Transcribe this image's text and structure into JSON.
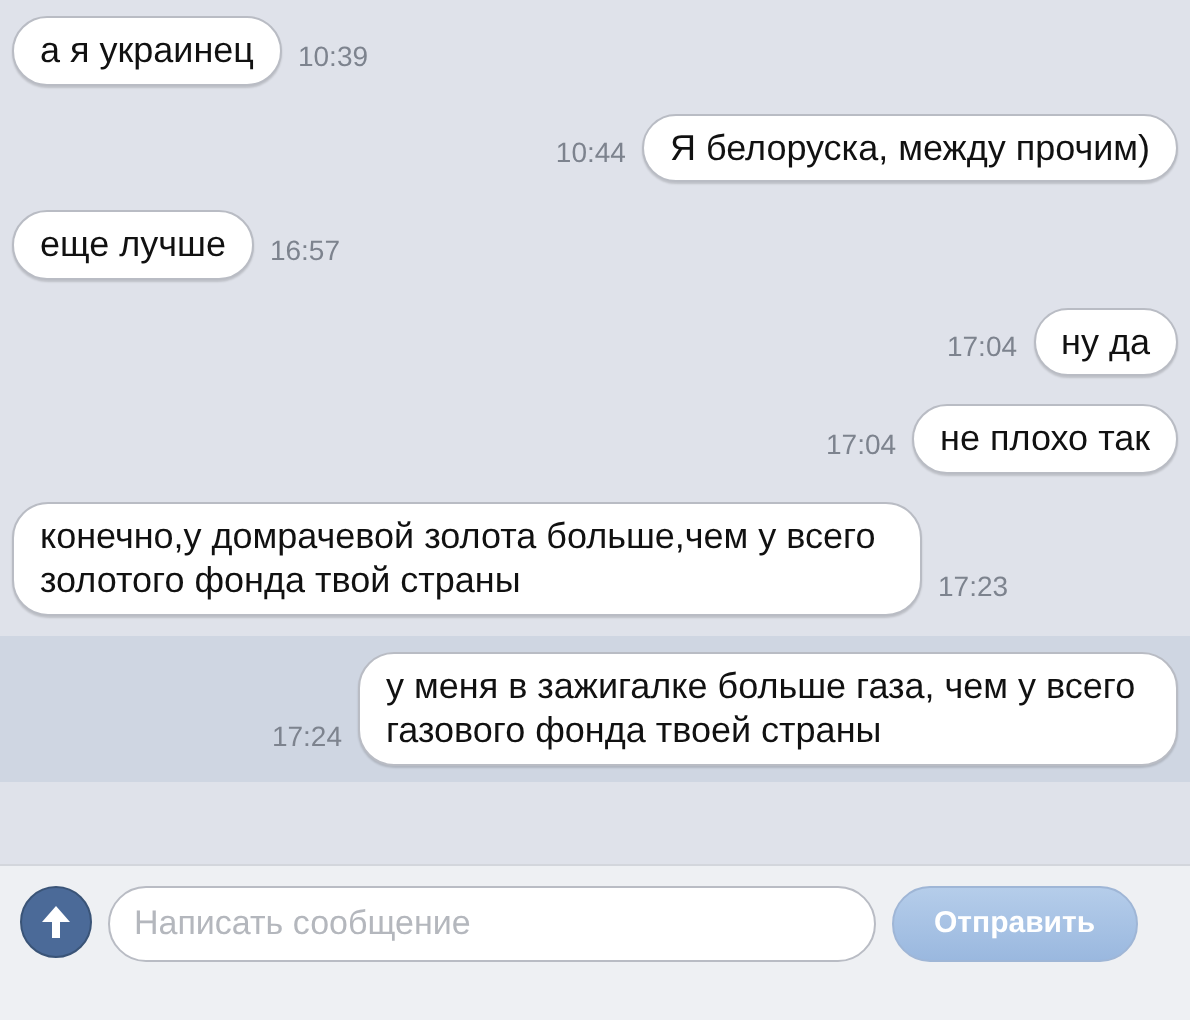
{
  "messages": [
    {
      "kind": "in",
      "text": "а я украинец",
      "time": "10:39",
      "selected": false
    },
    {
      "kind": "out",
      "text": "Я белоруска, между прочим)",
      "time": "10:44",
      "selected": false
    },
    {
      "kind": "in",
      "text": "еще лучше",
      "time": "16:57",
      "selected": false
    },
    {
      "kind": "out",
      "text": "ну да",
      "time": "17:04",
      "selected": false
    },
    {
      "kind": "out",
      "text": "не плохо так",
      "time": "17:04",
      "selected": false
    },
    {
      "kind": "in",
      "text": "конечно,у домрачевой золота больше,чем у всего золотого фонда твой страны",
      "time": "17:23",
      "selected": false
    },
    {
      "kind": "out",
      "text": "у меня в зажигалке больше газа, чем у всего газового фонда твоей страны",
      "time": "17:24",
      "selected": true
    }
  ],
  "composer": {
    "placeholder": "Написать сообщение",
    "send_button": "Отправить"
  }
}
